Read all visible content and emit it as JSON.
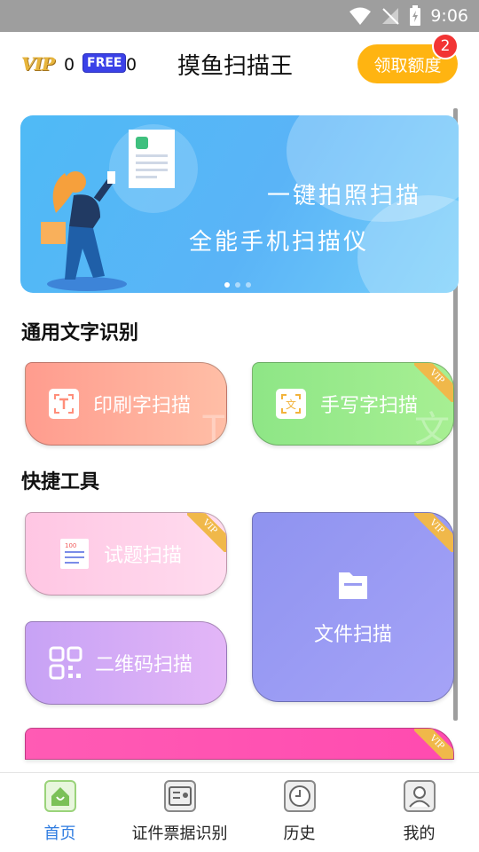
{
  "status_bar": {
    "time": "9:06"
  },
  "header": {
    "vip_logo": "VIP",
    "vip_count": "0",
    "free_label": "FREE",
    "free_count": "0",
    "title": "摸鱼扫描王",
    "quota_button": "领取额度",
    "quota_badge": "2"
  },
  "banner": {
    "line1": "一键拍照扫描",
    "line2": "全能手机扫描仪",
    "slide_count": 3,
    "active_slide": 1
  },
  "sections": {
    "ocr_title": "通用文字识别",
    "tools_title": "快捷工具"
  },
  "cards": {
    "print_scan": "印刷字扫描",
    "handwriting_scan": "手写字扫描",
    "exam_scan": "试题扫描",
    "qr_scan": "二维码扫描",
    "file_scan": "文件扫描",
    "vip_tag": "VIP"
  },
  "tabs": [
    {
      "label": "首页",
      "icon": "home-icon",
      "active": true
    },
    {
      "label": "证件票据识别",
      "icon": "id-card-icon",
      "active": false
    },
    {
      "label": "历史",
      "icon": "clock-icon",
      "active": false
    },
    {
      "label": "我的",
      "icon": "user-icon",
      "active": false
    }
  ],
  "colors": {
    "accent_blue": "#2f7ce0",
    "quota_orange": "#ffb411",
    "badge_red": "#f23434",
    "free_blue": "#3b41e8"
  }
}
